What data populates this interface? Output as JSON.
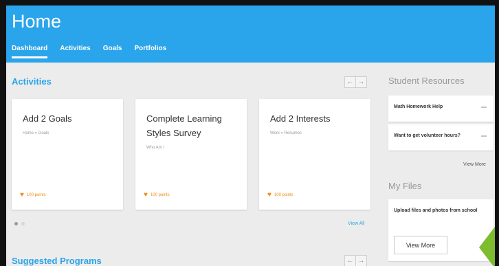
{
  "header": {
    "title": "Home",
    "tabs": [
      {
        "label": "Dashboard",
        "active": true
      },
      {
        "label": "Activities",
        "active": false
      },
      {
        "label": "Goals",
        "active": false
      },
      {
        "label": "Portfolios",
        "active": false
      }
    ]
  },
  "activities": {
    "title": "Activities",
    "pager": {
      "prev": "←",
      "next": "→"
    },
    "cards": [
      {
        "title": "Add 2 Goals",
        "path": "Home » Goals",
        "points": "100 points"
      },
      {
        "title": "Complete Learning Styles Survey",
        "path": "Who Am I",
        "points": "100 points"
      },
      {
        "title": "Add 2 Interests",
        "path": "Work » Resumes",
        "points": "100 points"
      }
    ],
    "view_all": "View All"
  },
  "suggested": {
    "title": "Suggested Programs",
    "pager": {
      "prev": "←",
      "next": "→"
    }
  },
  "student_resources": {
    "title": "Student Resources",
    "items": [
      "Math Homework Help",
      "Want to get volunteer hours?"
    ],
    "view_more": "View More"
  },
  "my_files": {
    "title": "My Files",
    "text": "Upload files and photos from school",
    "button": "View More"
  },
  "colors": {
    "brand": "#2aa4ea",
    "points": "#f08a16",
    "accent_arrow": "#7dbb2f"
  }
}
